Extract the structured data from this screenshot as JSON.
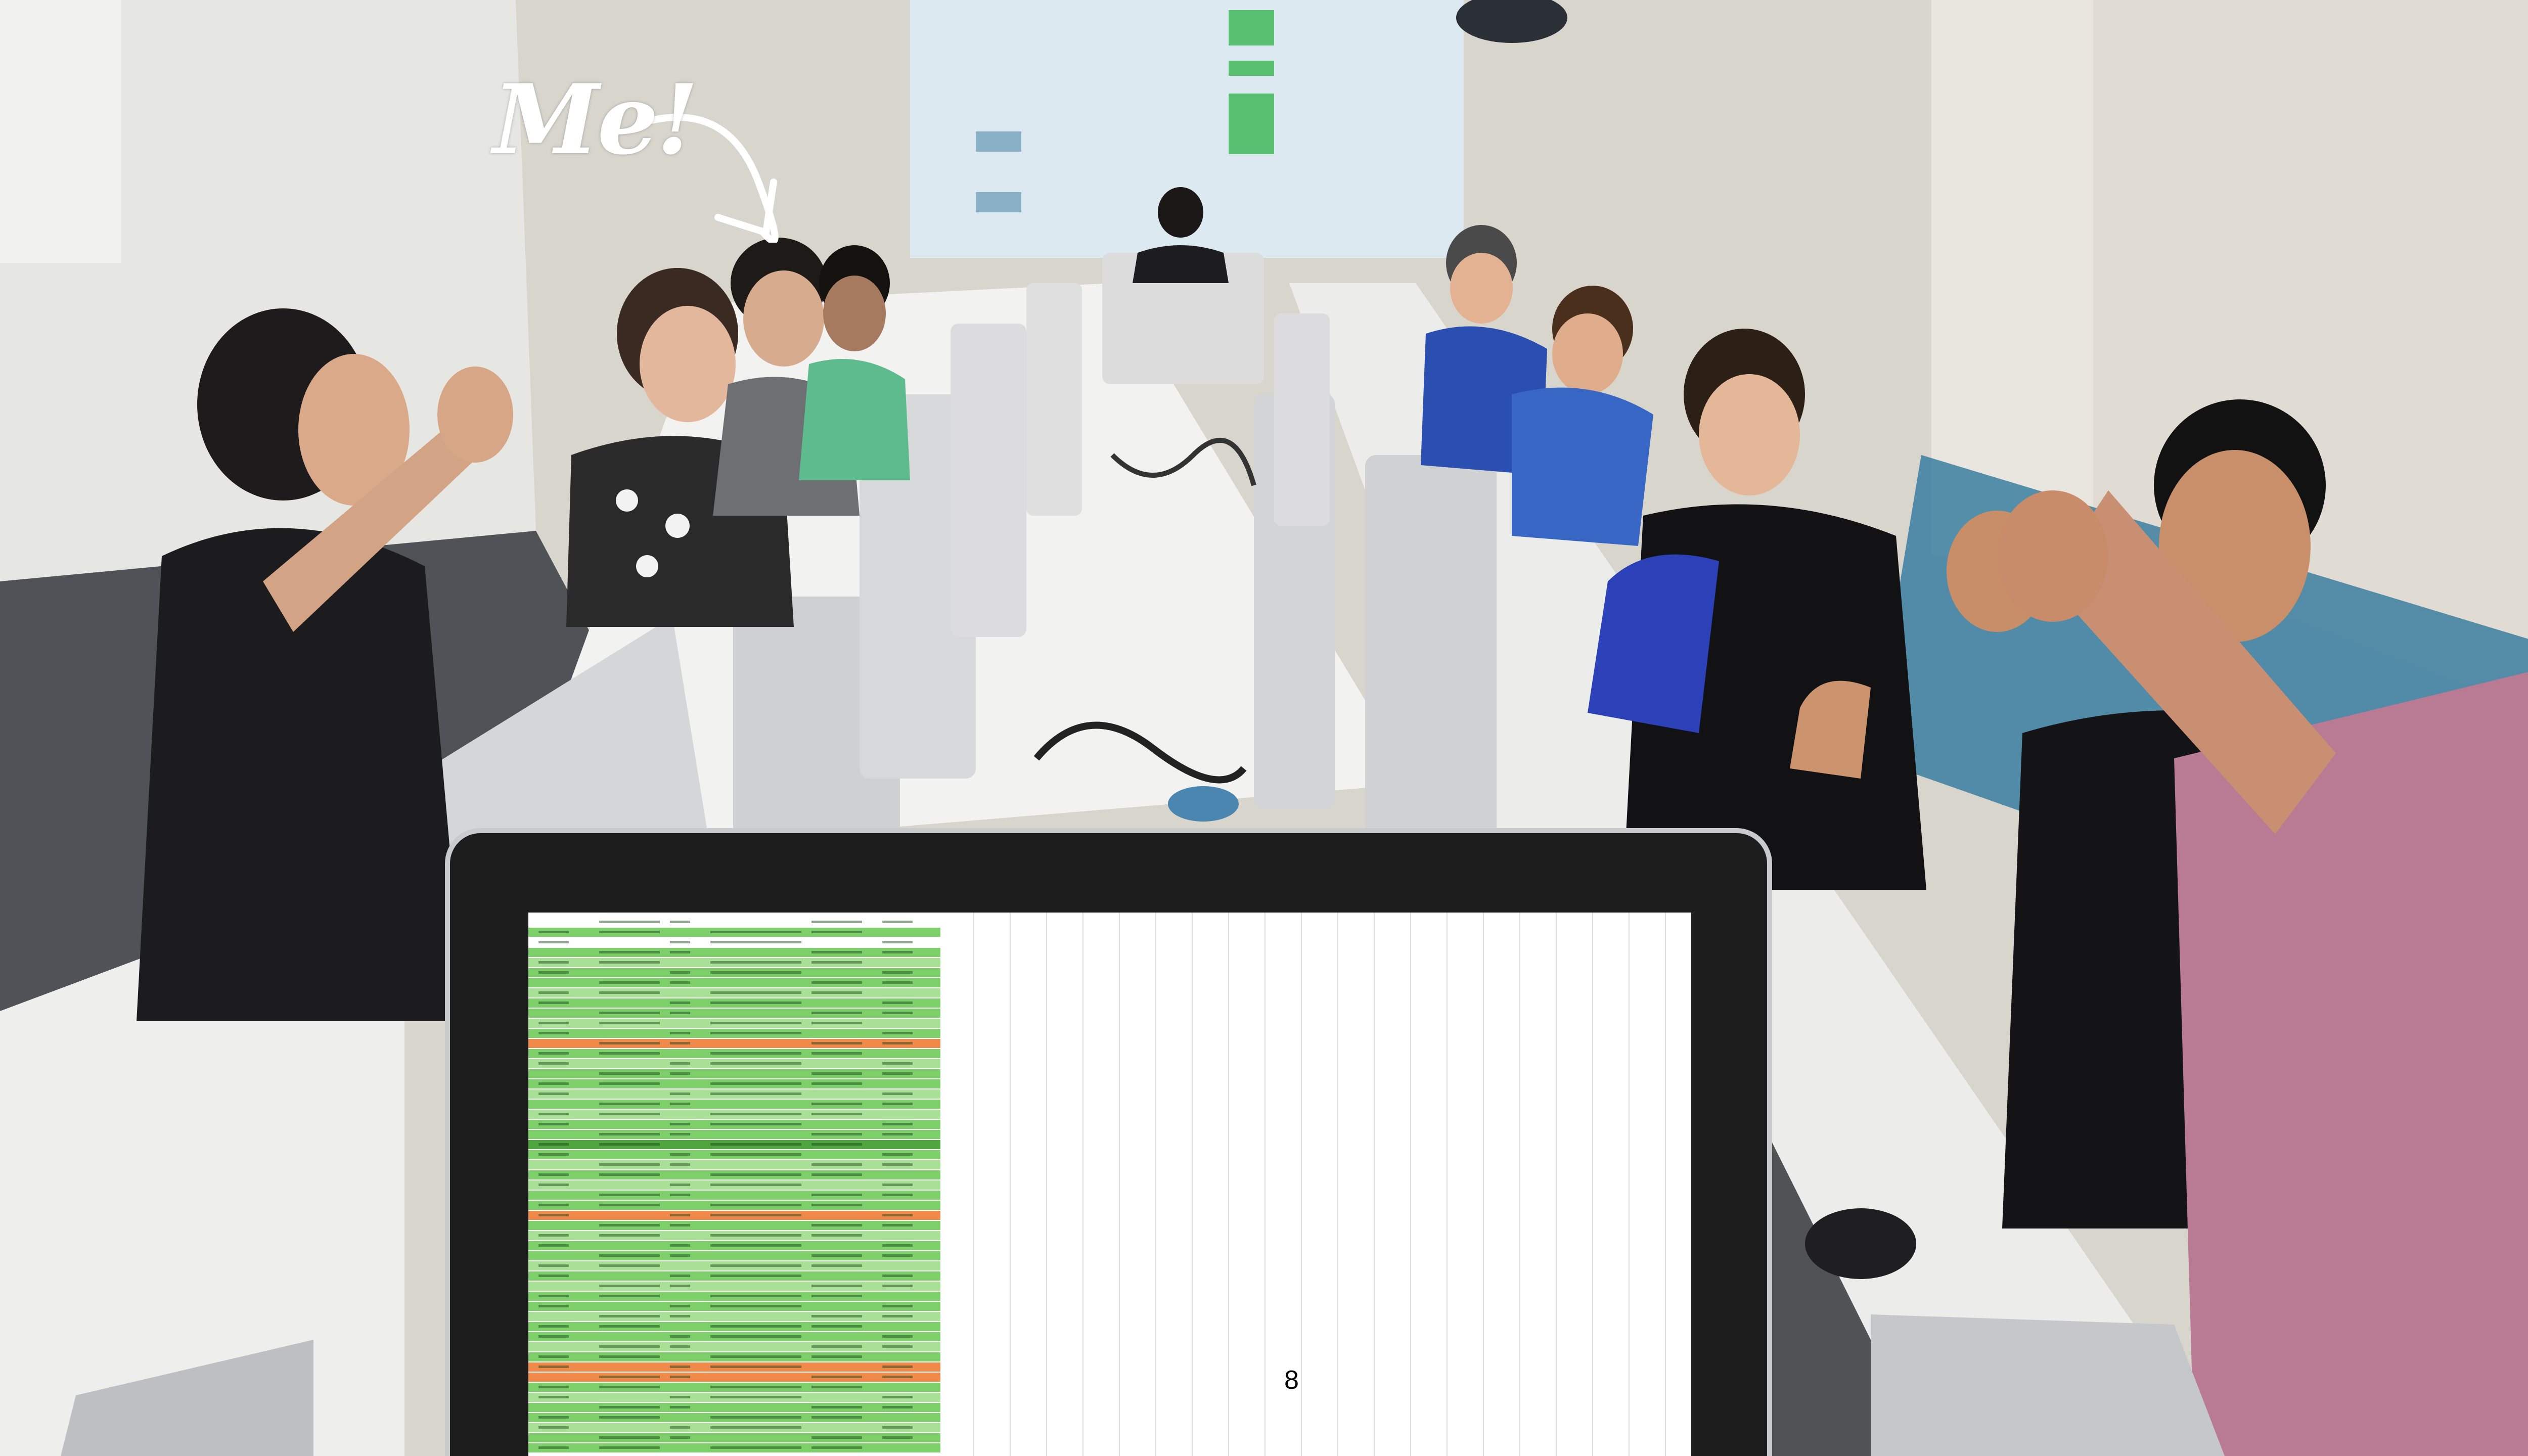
{
  "annotation": {
    "text": "Me!"
  },
  "slide": {
    "page_number": "8"
  },
  "colors": {
    "annotation": "#ffffff",
    "screen_background": "#ffffff",
    "sheet_green": "#7dcf6a",
    "sheet_green_light": "#a8e095",
    "sheet_orange": "#f08a4b",
    "monitor_bezel": "#1d1d1e"
  },
  "sheet_rows": [
    "h",
    "g",
    "w",
    "g",
    "l",
    "g",
    "g",
    "l",
    "g",
    "g",
    "l",
    "g",
    "o",
    "g",
    "l",
    "g",
    "g",
    "l",
    "g",
    "l",
    "g",
    "g",
    "d",
    "g",
    "l",
    "g",
    "l",
    "g",
    "g",
    "o",
    "g",
    "l",
    "g",
    "g",
    "l",
    "g",
    "l",
    "g",
    "g",
    "l",
    "g",
    "g",
    "l",
    "g",
    "o",
    "o",
    "g",
    "l",
    "g",
    "g",
    "l",
    "g",
    "g"
  ]
}
